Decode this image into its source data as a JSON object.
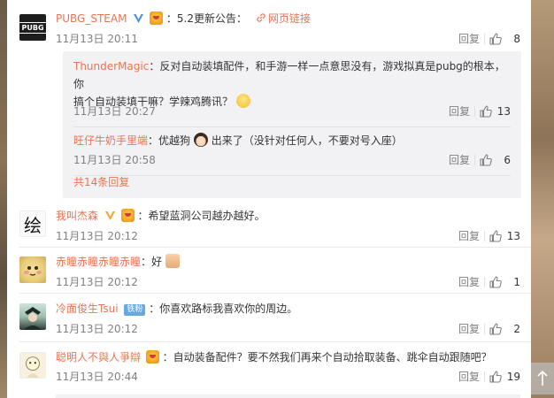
{
  "main_comment": {
    "username": "PUBG_STEAM",
    "text": "：5.2更新公告：",
    "link": "网页链接",
    "time": "11月13日 20:11",
    "reply": "回复",
    "likes": "8"
  },
  "replies": [
    {
      "username": "ThunderMagic",
      "text_line1": "：反对自动装填配件，和手游一样一点意思没有，游戏拟真是pubg的根本，你",
      "text_line2": "搞个自动装填干嘛？学辣鸡腾讯？",
      "time": "11月13日 20:27",
      "reply": "回复",
      "likes": "13"
    },
    {
      "username": "旺仔牛奶手里端",
      "text_a": "：优越狗",
      "text_b": "出来了（没针对任何人，不要对号入座）",
      "time": "11月13日 20:58",
      "reply": "回复",
      "likes": "6"
    }
  ],
  "more_replies": "共14条回复",
  "comments": [
    {
      "username": "我叫杰森",
      "text": "：希望蓝洞公司越办越好。",
      "time": "11月13日 20:12",
      "reply": "回复",
      "likes": "13"
    },
    {
      "username": "赤瞳赤瞳赤瞳赤瞳",
      "text": "：好",
      "time": "11月13日 20:12",
      "reply": "回复",
      "likes": "1"
    },
    {
      "username": "冷面俊生Tsui",
      "badge": "铁粉",
      "text": "：你喜欢路标我喜欢你的周边。",
      "time": "11月13日 20:12",
      "reply": "回复",
      "likes": "2"
    },
    {
      "username": "聪明人不與人爭辯",
      "text": "：自动装备配件？要不然我们再来个自动拾取装备、跳伞自动跟随吧？",
      "time": "11月13日 20:44",
      "reply": "回复",
      "likes": "19"
    }
  ],
  "avatars": {
    "pubg": "PUBG",
    "jason": "绘"
  },
  "colors": {
    "username": "#eb7350",
    "meta": "#808080",
    "subbox_bg": "#f2f2f5"
  },
  "icons": [
    "verified-icon",
    "link-icon",
    "thumbs-up-icon",
    "back-to-top-icon"
  ]
}
